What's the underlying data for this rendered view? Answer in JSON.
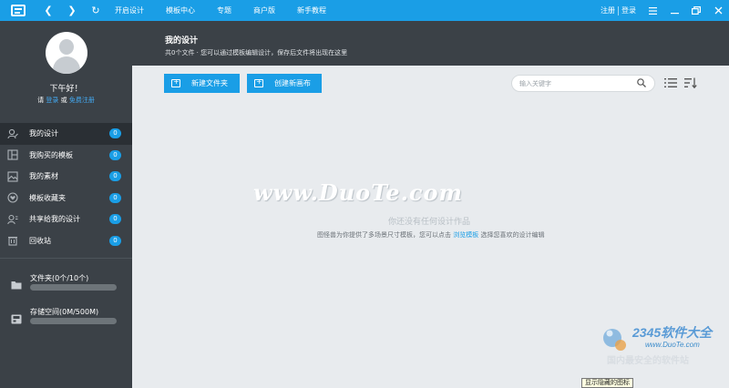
{
  "topbar": {
    "menu": [
      "开启设计",
      "模板中心",
      "专题",
      "商户版",
      "新手教程"
    ],
    "register": "注册",
    "login": "登录"
  },
  "sidebar": {
    "greeting": "下午好！",
    "login_prompt": {
      "prefix": "请",
      "login": "登录",
      "or": "或",
      "register": "免费注册"
    },
    "items": [
      {
        "label": "我的设计",
        "count": "0",
        "icon": "user-design-icon",
        "active": true
      },
      {
        "label": "我购买的模板",
        "count": "0",
        "icon": "template-icon",
        "active": false
      },
      {
        "label": "我的素材",
        "count": "0",
        "icon": "material-icon",
        "active": false
      },
      {
        "label": "模板收藏夹",
        "count": "0",
        "icon": "favorite-icon",
        "active": false
      },
      {
        "label": "共享给我的设计",
        "count": "0",
        "icon": "shared-icon",
        "active": false
      },
      {
        "label": "回收站",
        "count": "0",
        "icon": "trash-icon",
        "active": false
      }
    ],
    "folders_label": "文件夹(0个/10个)",
    "storage_label": "存储空间(0M/500M)"
  },
  "header": {
    "title": "我的设计",
    "subtitle": "共0个文件 · 您可以通过模板编辑设计，保存后文件将出现在这里"
  },
  "toolbar": {
    "new_folder": "新建文件夹",
    "new_canvas": "创建新画布",
    "search_placeholder": "输入关键字"
  },
  "empty": {
    "watermark": "www.DuoTe.com",
    "title": "你还没有任何设计作品",
    "desc_before": "图怪兽为你提供了多场景尺寸模板，您可以点击",
    "desc_link": "浏览模板",
    "desc_after": "选择您喜欢的设计编辑"
  },
  "branding": {
    "name": "2345软件大全",
    "url": "www.DuoTe.com",
    "slogan": "国内最安全的软件站"
  },
  "tooltip": "显示隐藏的图标",
  "colors": {
    "accent": "#1a9ee6",
    "sidebar": "#3b4147",
    "content": "#e8ebee"
  }
}
